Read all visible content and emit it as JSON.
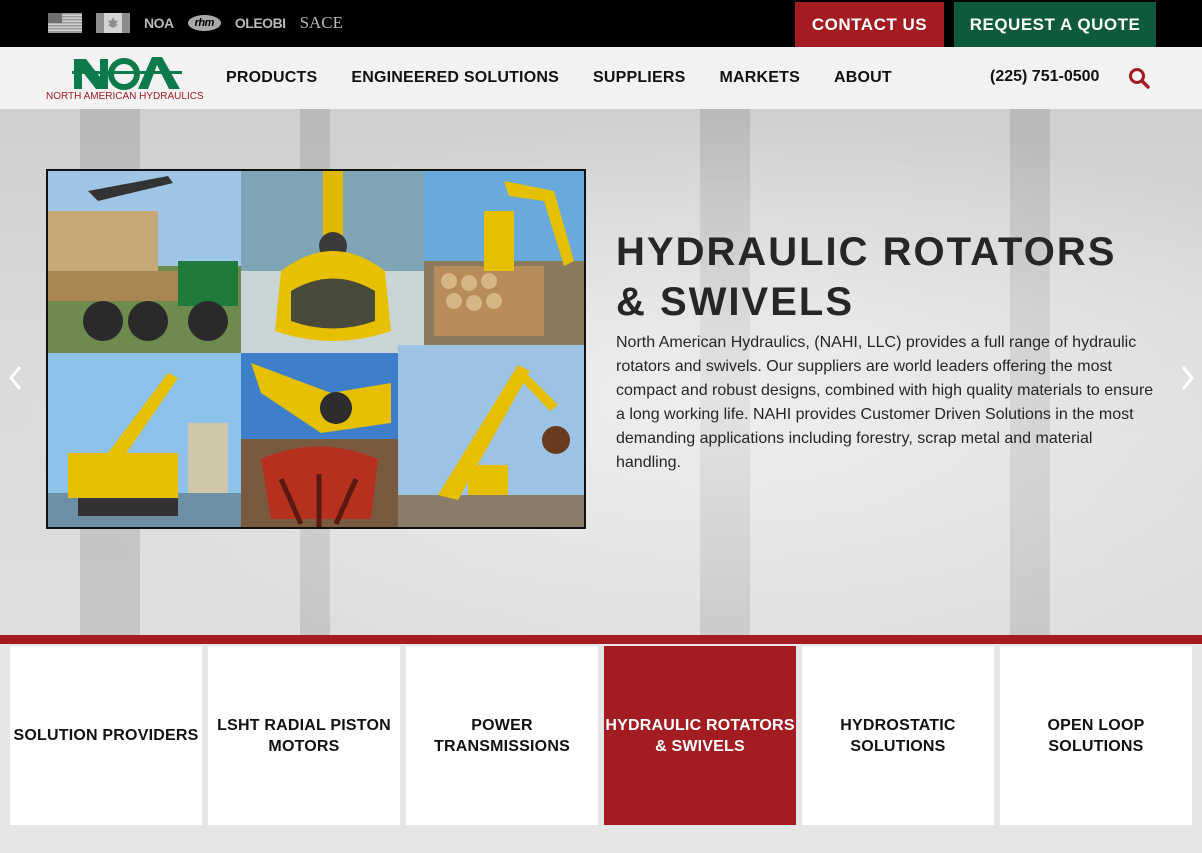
{
  "topbar": {
    "logos": [
      "NOA",
      "rhm",
      "OLEOBI",
      "SACE"
    ],
    "contact_label": "CONTACT US",
    "quote_label": "REQUEST A QUOTE"
  },
  "header": {
    "logo_text": "NORTH AMERICAN HYDRAULICS",
    "nav": [
      "PRODUCTS",
      "ENGINEERED SOLUTIONS",
      "SUPPLIERS",
      "MARKETS",
      "ABOUT"
    ],
    "phone": "(225) 751-0500"
  },
  "hero": {
    "title": "HYDRAULIC ROTATORS & SWIVELS",
    "body": "North American Hydraulics, (NAHI, LLC) provides a full range of hydraulic rotators and swivels. Our suppliers are world leaders offering the most compact and robust designs, combined with high quality materials to ensure a long working life. NAHI provides Customer Driven Solutions in the most demanding applications including forestry, scrap metal and material handling."
  },
  "categories": [
    {
      "label": "SOLUTION PROVIDERS",
      "active": false
    },
    {
      "label": "LSHT RADIAL PISTON MOTORS",
      "active": false
    },
    {
      "label": "POWER TRANSMISSIONS",
      "active": false
    },
    {
      "label": "HYDRAULIC ROTATORS & SWIVELS",
      "active": true
    },
    {
      "label": "HYDROSTATIC SOLUTIONS",
      "active": false
    },
    {
      "label": "OPEN LOOP SOLUTIONS",
      "active": false
    }
  ],
  "colors": {
    "brand_red": "#a21c21",
    "brand_green": "#0d5a3c",
    "topbar_bg": "#000000",
    "nav_bg": "#f2f2f2"
  },
  "icons": {
    "search": "search-icon",
    "prev": "chevron-left-icon",
    "next": "chevron-right-icon",
    "flags": [
      "us-flag-icon",
      "canada-flag-icon"
    ]
  }
}
